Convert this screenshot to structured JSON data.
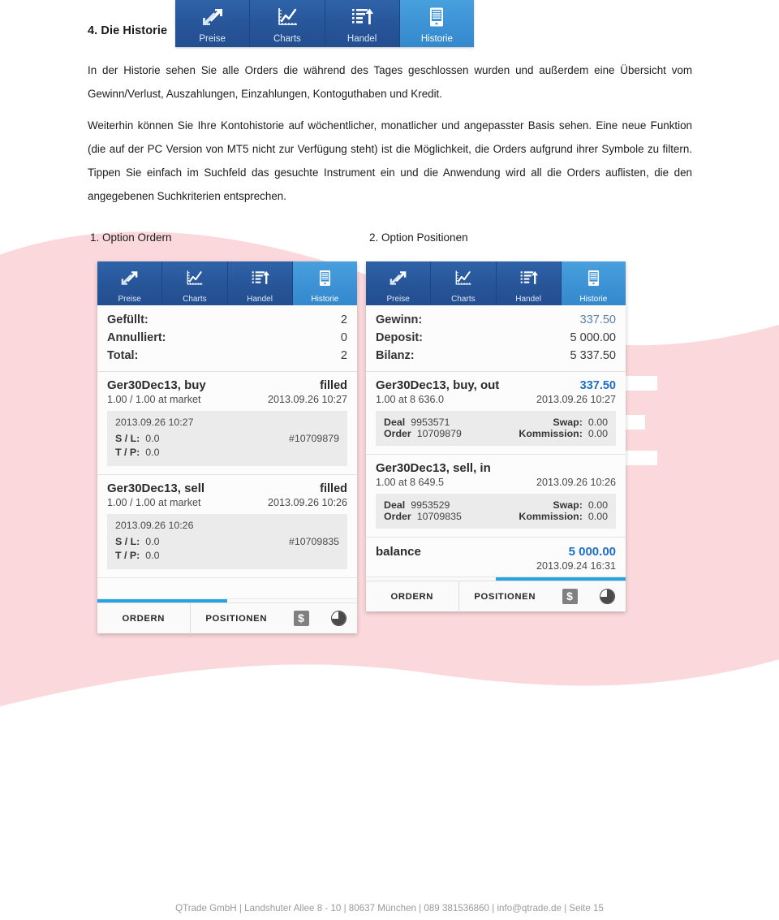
{
  "section": {
    "heading": "4. Die Historie"
  },
  "top_nav": {
    "items": [
      {
        "label": "Preise",
        "icon": "expand-arrows-icon",
        "active": false
      },
      {
        "label": "Charts",
        "icon": "line-chart-icon",
        "active": false
      },
      {
        "label": "Handel",
        "icon": "list-arrow-up-icon",
        "active": false
      },
      {
        "label": "Historie",
        "icon": "document-tablet-icon",
        "active": true
      }
    ]
  },
  "body": {
    "paragraph_1": "In der Historie sehen Sie alle Orders die während des Tages geschlossen wurden und außerdem eine Übersicht vom Gewinn/Verlust, Auszahlungen, Einzahlungen, Kontoguthaben und Kredit.",
    "paragraph_2": "Weiterhin können Sie Ihre Kontohistorie auf wöchentlicher, monatlicher und angepasster Basis sehen. Eine neue Funktion (die auf der PC Version von MT5 nicht zur Verfügung steht) ist die Möglichkeit, die Orders aufgrund ihrer Symbole zu filtern. Tippen Sie einfach im Suchfeld das gesuchte Instrument ein und die Anwendung wird all die Orders auflisten, die den angegebenen Suchkriterien entsprechen."
  },
  "captions": {
    "phone_1": "1. Option Ordern",
    "phone_2": "2. Option Positionen"
  },
  "phone_1": {
    "nav": [
      {
        "label": "Preise",
        "active": false
      },
      {
        "label": "Charts",
        "active": false
      },
      {
        "label": "Handel",
        "active": false
      },
      {
        "label": "Historie",
        "active": true
      }
    ],
    "summary": [
      {
        "key": "Gefüllt:",
        "value": "2"
      },
      {
        "key": "Annulliert:",
        "value": "0"
      },
      {
        "key": "Total:",
        "value": "2"
      }
    ],
    "orders": [
      {
        "title": "Ger30Dec13, buy",
        "status": "filled",
        "volume": "1.00 / 1.00 at market",
        "time": "2013.09.26 10:27",
        "detail_time": "2013.09.26 10:27",
        "sl_label": "S / L:",
        "sl_value": "0.0",
        "tp_label": "T / P:",
        "tp_value": "0.0",
        "ticket": "#10709879"
      },
      {
        "title": "Ger30Dec13, sell",
        "status": "filled",
        "volume": "1.00 / 1.00 at market",
        "time": "2013.09.26 10:26",
        "detail_time": "2013.09.26 10:26",
        "sl_label": "S / L:",
        "sl_value": "0.0",
        "tp_label": "T / P:",
        "tp_value": "0.0",
        "ticket": "#10709835"
      }
    ],
    "tabbar": {
      "tab_1": "ORDERN",
      "tab_2": "POSITIONEN",
      "active_tab": 0,
      "icon_1": "dollar-icon",
      "icon_2": "clock-icon"
    }
  },
  "phone_2": {
    "nav": [
      {
        "label": "Preise",
        "active": false
      },
      {
        "label": "Charts",
        "active": false
      },
      {
        "label": "Handel",
        "active": false
      },
      {
        "label": "Historie",
        "active": true
      }
    ],
    "summary": [
      {
        "key": "Gewinn:",
        "value": "337.50",
        "accent": true
      },
      {
        "key": "Deposit:",
        "value": "5 000.00",
        "accent": false
      },
      {
        "key": "Bilanz:",
        "value": "5 337.50",
        "accent": false
      }
    ],
    "deals": [
      {
        "title": "Ger30Dec13, buy, out",
        "profit": "337.50",
        "volume": "1.00 at 8 636.0",
        "time": "2013.09.26 10:27",
        "deal_label": "Deal",
        "deal_value": "9953571",
        "order_label": "Order",
        "order_value": "10709879",
        "swap_label": "Swap:",
        "swap_value": "0.00",
        "commission_label": "Kommission:",
        "commission_value": "0.00"
      },
      {
        "title": "Ger30Dec13, sell, in",
        "profit": "",
        "volume": "1.00 at 8 649.5",
        "time": "2013.09.26 10:26",
        "deal_label": "Deal",
        "deal_value": "9953529",
        "order_label": "Order",
        "order_value": "10709835",
        "swap_label": "Swap:",
        "swap_value": "0.00",
        "commission_label": "Kommission:",
        "commission_value": "0.00"
      }
    ],
    "balance": {
      "title": "balance",
      "amount": "5 000.00",
      "time": "2013.09.24 16:31"
    },
    "tabbar": {
      "tab_1": "ORDERN",
      "tab_2": "POSITIONEN",
      "active_tab": 1,
      "icon_1": "dollar-icon",
      "icon_2": "clock-icon"
    }
  },
  "footer": {
    "text": "QTrade GmbH | Landshuter Allee 8 - 10 | 80637 München | 089 381536860 | info@qtrade.de | Seite 15"
  },
  "colors": {
    "nav_blue": "#2a5a9e",
    "nav_blue_active": "#3c92d4",
    "accent_blue": "#1d6fc4",
    "tab_indicator": "#27a4e0",
    "pink_band": "#fbd8dc",
    "footer_gray": "#9a9a9a"
  }
}
